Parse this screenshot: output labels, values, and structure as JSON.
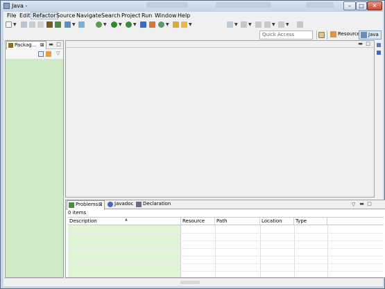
{
  "window": {
    "title": "Java -",
    "controls": [
      "minimize",
      "maximize",
      "close"
    ]
  },
  "menubar": {
    "items": [
      "File",
      "Edit",
      "Refactor",
      "Source",
      "Navigate",
      "Search",
      "Project",
      "Run",
      "Window",
      "Help"
    ],
    "active_item": "Refactor"
  },
  "toolbar": {
    "icons": [
      "new-icon",
      "save-icon",
      "save-all-icon",
      "print-icon",
      "new-java-package-icon",
      "new-java-class-icon",
      "task-icon",
      "debug-icon",
      "run-icon",
      "run-external-icon",
      "open-type-icon",
      "search-icon",
      "back-icon",
      "forward-icon",
      "pin-icon"
    ]
  },
  "quick_access": {
    "placeholder": "Quick Access"
  },
  "perspectives": {
    "open_label": "open-perspective-icon",
    "items": [
      {
        "label": "Resource",
        "active": false
      },
      {
        "label": "Java",
        "active": true
      }
    ]
  },
  "package_explorer": {
    "tab_label": "Packag...",
    "close_glyph": "⊠"
  },
  "problems_view": {
    "tabs": [
      {
        "label": "Problems",
        "active": true,
        "close": "⊠"
      },
      {
        "label": "Javadoc",
        "active": false
      },
      {
        "label": "Declaration",
        "active": false
      }
    ],
    "status": "0 items",
    "columns": [
      "Description",
      "Resource",
      "Path",
      "Location",
      "Type"
    ],
    "rows": []
  },
  "colors": {
    "pkg_body": "#cfe8c8",
    "desc_column": "#dff5d6",
    "titlebar": "#c9d6e6",
    "active_persp": "#dce8f5"
  }
}
